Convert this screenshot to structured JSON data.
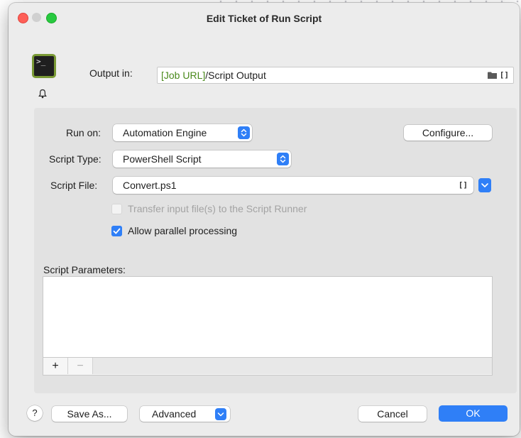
{
  "window": {
    "title": "Edit Ticket of Run Script"
  },
  "header": {
    "output_label": "Output in:",
    "output_token": "[Job URL]",
    "output_path": "/Script Output",
    "variable_icon_text": "[]"
  },
  "form": {
    "run_on_label": "Run on:",
    "run_on_value": "Automation Engine",
    "configure_label": "Configure...",
    "script_type_label": "Script Type:",
    "script_type_value": "PowerShell Script",
    "script_file_label": "Script File:",
    "script_file_value": "Convert.ps1",
    "script_file_var_icon": "[]",
    "transfer_label": "Transfer input file(s) to the Script Runner",
    "transfer_checked": false,
    "parallel_label": "Allow parallel processing",
    "parallel_checked": true,
    "params_label": "Script Parameters:",
    "add_label": "+",
    "remove_label": "−"
  },
  "footer": {
    "help_label": "?",
    "save_as_label": "Save As...",
    "advanced_label": "Advanced",
    "cancel_label": "Cancel",
    "ok_label": "OK"
  },
  "colors": {
    "accent": "#2f7ff7",
    "job_url_token": "#4a8a1c",
    "close": "#fe5f57",
    "maximize": "#28c940",
    "app_icon": "#7a9a35"
  },
  "icons": [
    "terminal-icon",
    "bell-icon",
    "folder-icon",
    "variable-icon",
    "stepper-icon",
    "chevron-down-icon",
    "checkmark-icon",
    "help-icon"
  ]
}
